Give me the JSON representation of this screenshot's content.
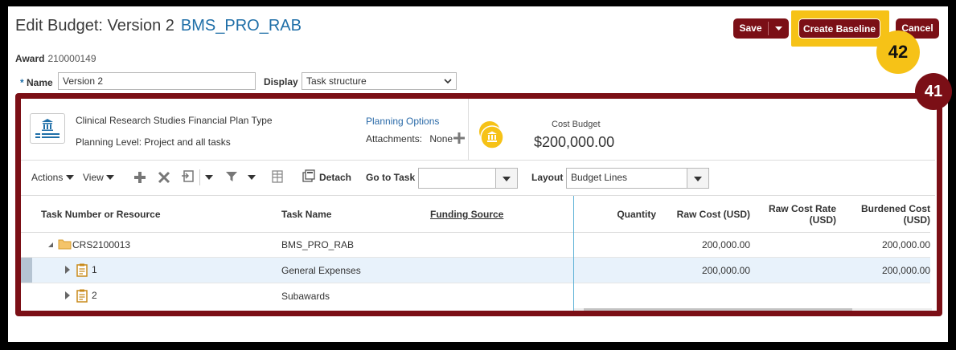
{
  "header": {
    "title": "Edit Budget: Version 2",
    "project": "BMS_PRO_RAB",
    "award_label": "Award",
    "award_value": "210000149",
    "save_label": "Save",
    "create_baseline_label": "Create Baseline",
    "cancel_label": "Cancel"
  },
  "form": {
    "name_required": "*",
    "name_label": "Name",
    "name_value": "Version 2",
    "display_label": "Display",
    "display_value": "Task structure"
  },
  "callouts": {
    "step_a": "42",
    "step_b": "41"
  },
  "summary": {
    "plan_type": "Clinical Research Studies Financial Plan Type",
    "planning_level": "Planning Level: Project and all tasks",
    "planning_options": "Planning Options",
    "attachments_label": "Attachments:",
    "attachments_value": "None",
    "cost_budget_label": "Cost Budget",
    "cost_budget_value": "$200,000.00"
  },
  "toolbar": {
    "actions": "Actions",
    "view": "View",
    "detach": "Detach",
    "goto_task": "Go to Task",
    "layout_label": "Layout",
    "layout_value": "Budget Lines"
  },
  "table": {
    "headers": {
      "task_number": "Task Number or Resource",
      "task_name": "Task Name",
      "funding_source": "Funding Source",
      "quantity": "Quantity",
      "raw_cost": "Raw Cost (USD)",
      "raw_cost_rate_1": "Raw Cost Rate",
      "raw_cost_rate_2": "(USD)",
      "burdened_cost_1": "Burdened Cost",
      "burdened_cost_2": "(USD)"
    },
    "rows": [
      {
        "number": "CRS2100013",
        "name": "BMS_PRO_RAB",
        "raw_cost": "200,000.00",
        "burdened_cost": "200,000.00"
      },
      {
        "number": "1",
        "name": "General Expenses",
        "raw_cost": "200,000.00",
        "burdened_cost": "200,000.00"
      },
      {
        "number": "2",
        "name": "Subawards",
        "raw_cost": "",
        "burdened_cost": ""
      }
    ]
  },
  "colors": {
    "brand_red": "#7b0f16",
    "callout_yellow": "#f6c217",
    "link_blue": "#1f6fa8",
    "selected_row": "#e8f2fb"
  }
}
